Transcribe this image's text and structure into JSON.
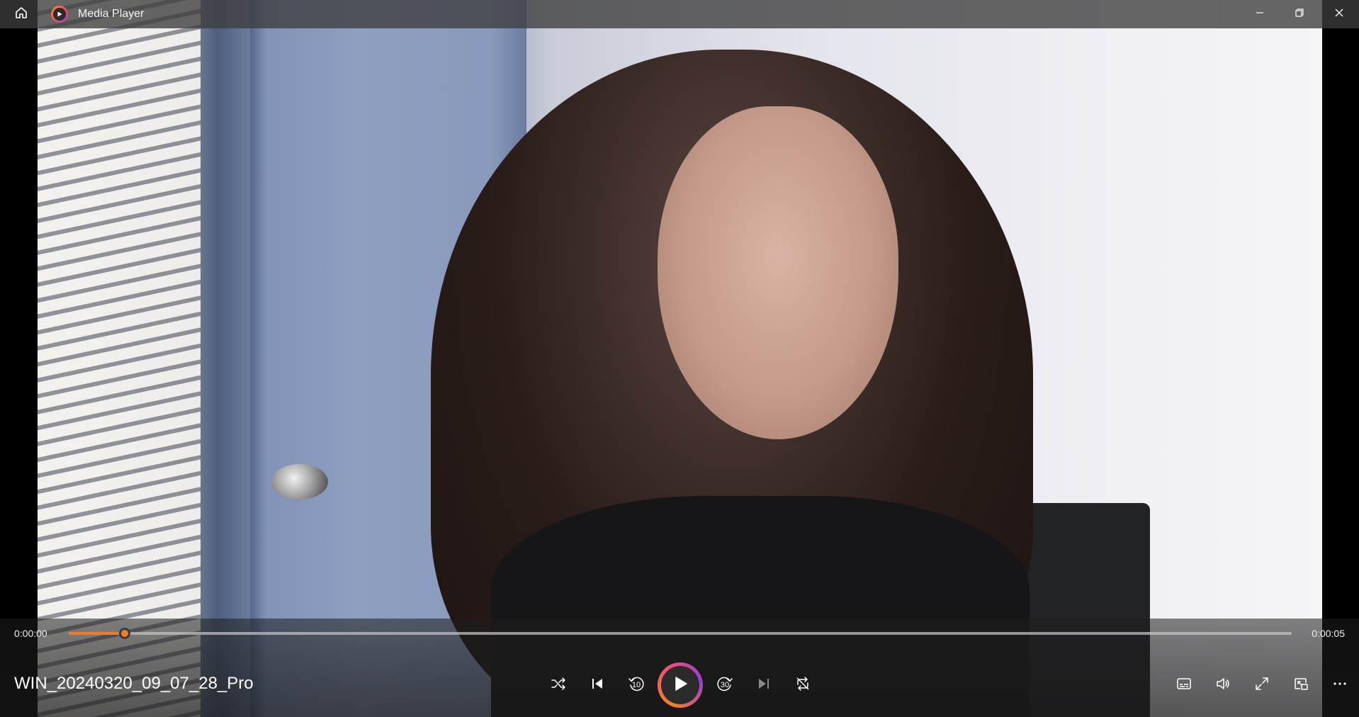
{
  "window": {
    "app_title": "Media Player"
  },
  "player": {
    "file_title": "WIN_20240320_09_07_28_Pro",
    "current_time": "0:00:00",
    "total_time": "0:00:05",
    "progress_fraction": 0.046,
    "skip_back_seconds": "10",
    "skip_forward_seconds": "30",
    "accent_color": "#f07b2b"
  },
  "icons": {
    "titlebar": [
      "home-icon",
      "media-player-logo-icon",
      "minimize-icon",
      "restore-icon",
      "close-icon"
    ],
    "transport": [
      "shuffle-icon",
      "previous-icon",
      "skip-back-icon",
      "play-icon",
      "skip-forward-icon",
      "next-icon",
      "repeat-icon"
    ],
    "right": [
      "captions-icon",
      "volume-icon",
      "fullscreen-icon",
      "mini-player-icon",
      "more-icon"
    ]
  }
}
